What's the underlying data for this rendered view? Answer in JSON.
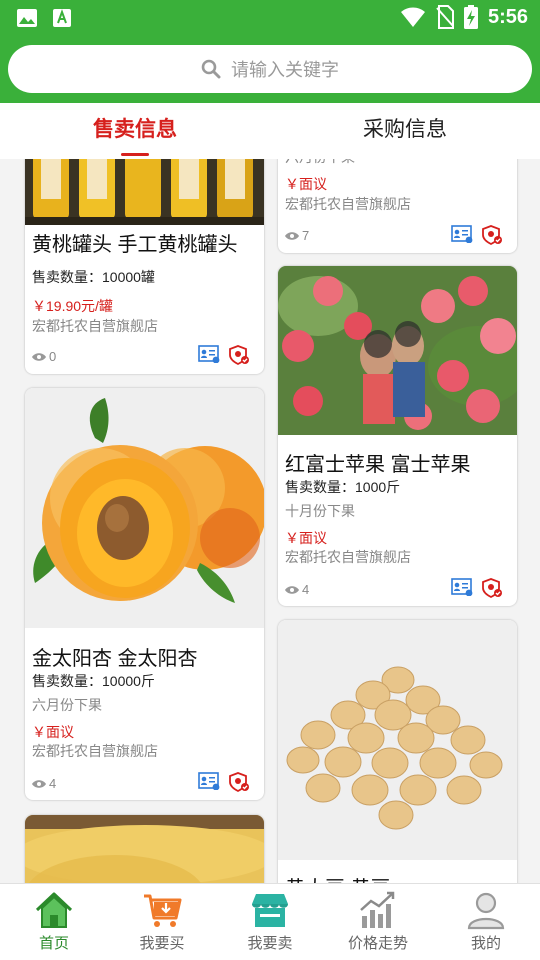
{
  "status_bar": {
    "time": "5:56"
  },
  "search": {
    "placeholder": "请输入关键字"
  },
  "tabs": [
    {
      "label": "售卖信息",
      "active": true
    },
    {
      "label": "采购信息",
      "active": false
    }
  ],
  "products": {
    "left": [
      {
        "title": "黄桃罐头 手工黄桃罐头",
        "quantity": "售卖数量：10000罐",
        "price": "￥19.90元/罐",
        "shop": "宏都托农自营旗舰店",
        "views": "0"
      },
      {
        "title": "金太阳杏 金太阳杏",
        "quantity": "售卖数量：10000斤",
        "harvest": "六月份下果",
        "price": "￥面议",
        "shop": "宏都托农自营旗舰店",
        "views": "4"
      }
    ],
    "right": [
      {
        "harvest": "六月份下果",
        "price": "￥面议",
        "shop": "宏都托农自营旗舰店",
        "views": "7"
      },
      {
        "title": "红富士苹果 富士苹果",
        "quantity": "售卖数量：1000斤",
        "harvest": "十月份下果",
        "price": "￥面议",
        "shop": "宏都托农自营旗舰店",
        "views": "4"
      },
      {
        "title": "黄大豆 黄豆"
      }
    ]
  },
  "bottom_nav": [
    {
      "label": "首页",
      "icon": "home-icon",
      "active": true
    },
    {
      "label": "我要买",
      "icon": "buy-cart-icon",
      "active": false
    },
    {
      "label": "我要卖",
      "icon": "sell-store-icon",
      "active": false
    },
    {
      "label": "价格走势",
      "icon": "price-trend-icon",
      "active": false
    },
    {
      "label": "我的",
      "icon": "profile-icon",
      "active": false
    }
  ],
  "colors": {
    "header_green": "#3ab03a",
    "accent_red": "#d6201d",
    "nav_active_green": "#2b8a2b"
  }
}
